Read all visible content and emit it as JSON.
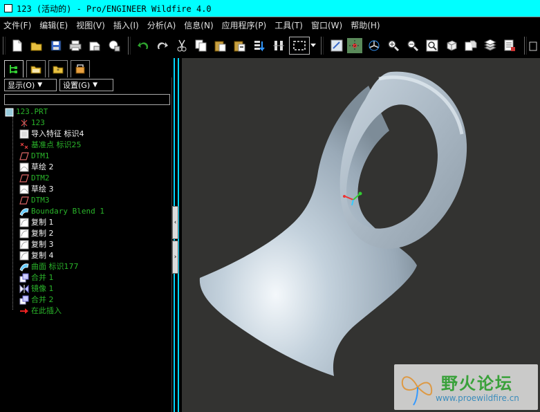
{
  "window": {
    "title": "123 (活动的) - Pro/ENGINEER Wildfire 4.0"
  },
  "menu": [
    "文件(F)",
    "编辑(E)",
    "视图(V)",
    "插入(I)",
    "分析(A)",
    "信息(N)",
    "应用程序(P)",
    "工具(T)",
    "窗口(W)",
    "帮助(H)"
  ],
  "toolbar": {
    "icons": [
      "new-file-icon",
      "open-file-icon",
      "save-icon",
      "print-icon",
      "send-email-icon",
      "view-model-icon",
      "undo-icon",
      "redo-icon",
      "cut-icon",
      "copy-icon",
      "paste-icon",
      "paste-special-icon",
      "regenerate-icon",
      "model-info-icon",
      "selection-box-icon",
      "dropdown-arrow-icon",
      "repaint-icon",
      "spin-center-icon",
      "orient-icon",
      "zoom-in-icon",
      "zoom-out-icon",
      "refit-icon",
      "saved-views-icon",
      "view-manager-icon",
      "layers-icon",
      "set-display-icon",
      "extra-icon"
    ]
  },
  "nav": {
    "tabs": [
      "model-tree-tab",
      "folder-browser-tab",
      "favorites-tab",
      "connections-tab"
    ],
    "show_label": "显示(O)",
    "settings_label": "设置(G)",
    "filter_value": ""
  },
  "tree": {
    "root": "123.PRT",
    "items": [
      {
        "label": "123",
        "icon": "csys-icon",
        "color": "green"
      },
      {
        "label": "导入特征 标识4",
        "icon": "import-feature-icon",
        "color": "white"
      },
      {
        "label": "基准点 标识25",
        "icon": "datum-point-icon",
        "color": "green"
      },
      {
        "label": "DTM1",
        "icon": "datum-plane-icon",
        "color": "green"
      },
      {
        "label": "草绘 2",
        "icon": "sketch-icon",
        "color": "white"
      },
      {
        "label": "DTM2",
        "icon": "datum-plane-icon",
        "color": "green"
      },
      {
        "label": "草绘 3",
        "icon": "sketch-icon",
        "color": "white"
      },
      {
        "label": "DTM3",
        "icon": "datum-plane-icon",
        "color": "green"
      },
      {
        "label": "Boundary Blend 1",
        "icon": "boundary-blend-icon",
        "color": "green"
      },
      {
        "label": "复制 1",
        "icon": "copy-feature-icon",
        "color": "white"
      },
      {
        "label": "复制 2",
        "icon": "copy-feature-icon",
        "color": "white"
      },
      {
        "label": "复制 3",
        "icon": "copy-feature-icon",
        "color": "white"
      },
      {
        "label": "复制 4",
        "icon": "copy-feature-icon",
        "color": "white"
      },
      {
        "label": "曲面 标识177",
        "icon": "surface-icon",
        "color": "green"
      },
      {
        "label": "合并 1",
        "icon": "merge-icon",
        "color": "green"
      },
      {
        "label": "镜像 1",
        "icon": "mirror-icon",
        "color": "green"
      },
      {
        "label": "合并 2",
        "icon": "merge-icon",
        "color": "green"
      },
      {
        "label": "在此插入",
        "icon": "insert-here-icon",
        "color": "green"
      }
    ]
  },
  "watermark": {
    "name": "野火论坛",
    "url": "www.proewildfire.cn"
  },
  "colors": {
    "title_bg": "#00ffff",
    "viewport_bg": "#333331",
    "tree_green": "#2ab52a",
    "model_fill": "#b8c8d6",
    "splitter": "#00d8ff"
  }
}
